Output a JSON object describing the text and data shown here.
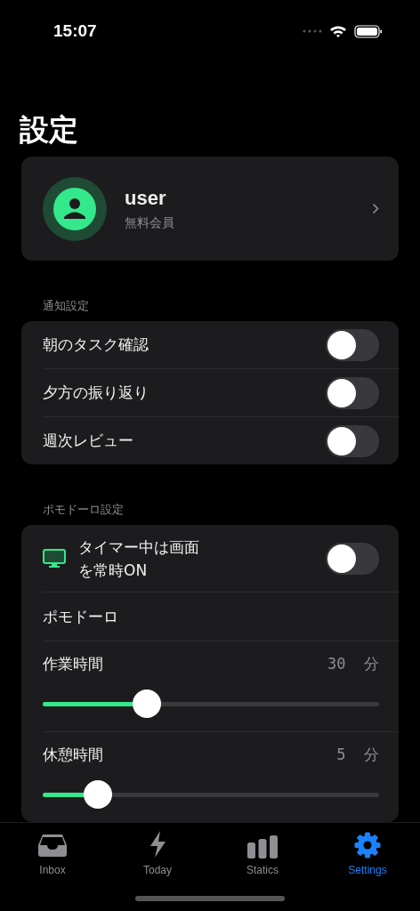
{
  "status_bar": {
    "time": "15:07"
  },
  "title": "設定",
  "profile": {
    "name": "user",
    "plan": "無料会員"
  },
  "notifications": {
    "header": "通知設定",
    "items": [
      {
        "label": "朝のタスク確認",
        "on": false
      },
      {
        "label": "夕方の振り返り",
        "on": false
      },
      {
        "label": "週次レビュー",
        "on": false
      }
    ]
  },
  "pomodoro": {
    "header": "ポモドーロ設定",
    "keep_screen_on": {
      "label": "タイマー中は画面を常時ON",
      "on": false
    },
    "subheader": "ポモドーロ",
    "sliders": [
      {
        "label": "作業時間",
        "value": "30",
        "unit": "分",
        "level": 0.31
      },
      {
        "label": "休憩時間",
        "value": "5",
        "unit": "分",
        "level": 0.164
      }
    ]
  },
  "tabs": [
    {
      "label": "Inbox",
      "selected": false
    },
    {
      "label": "Today",
      "selected": false
    },
    {
      "label": "Statics",
      "selected": false
    },
    {
      "label": "Settings",
      "selected": true
    }
  ]
}
